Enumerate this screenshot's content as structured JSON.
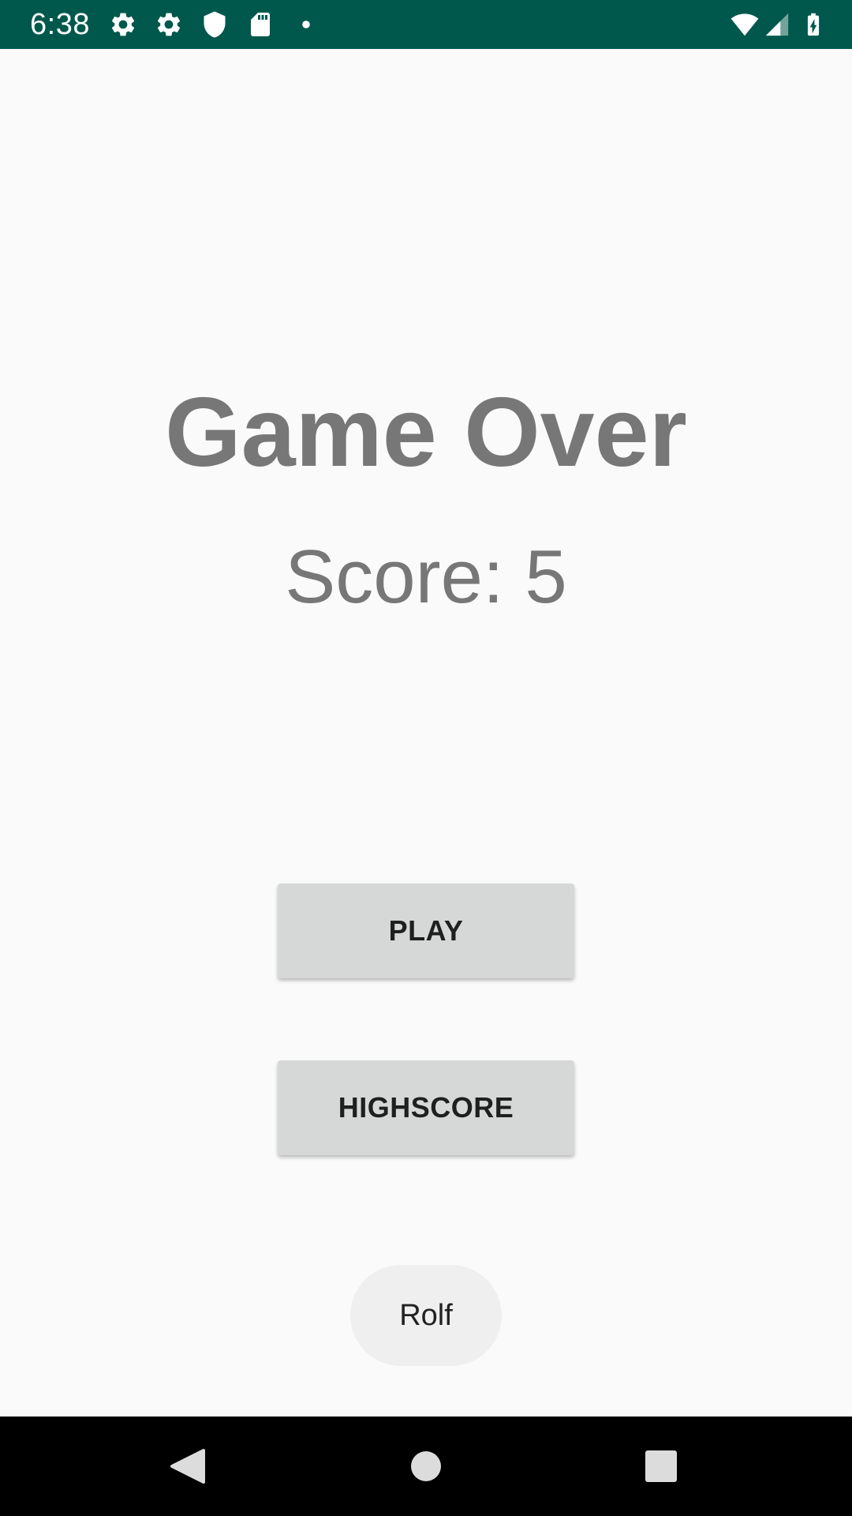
{
  "status_bar": {
    "time": "6:38",
    "left_icons": [
      "settings-icon",
      "settings-icon",
      "shield-icon",
      "sd-card-icon",
      "notification-dot-icon"
    ],
    "right_icons": [
      "wifi-icon",
      "signal-icon",
      "battery-charging-icon"
    ],
    "background_color": "#00584c"
  },
  "main": {
    "title": "Game Over",
    "score_text": "Score: 5",
    "text_color": "#777777",
    "play_label": "PLAY",
    "highscore_label": "HIGHSCORE",
    "player_name": "Rolf"
  },
  "nav_bar": {
    "buttons": [
      "back-icon",
      "home-icon",
      "recents-icon"
    ]
  }
}
